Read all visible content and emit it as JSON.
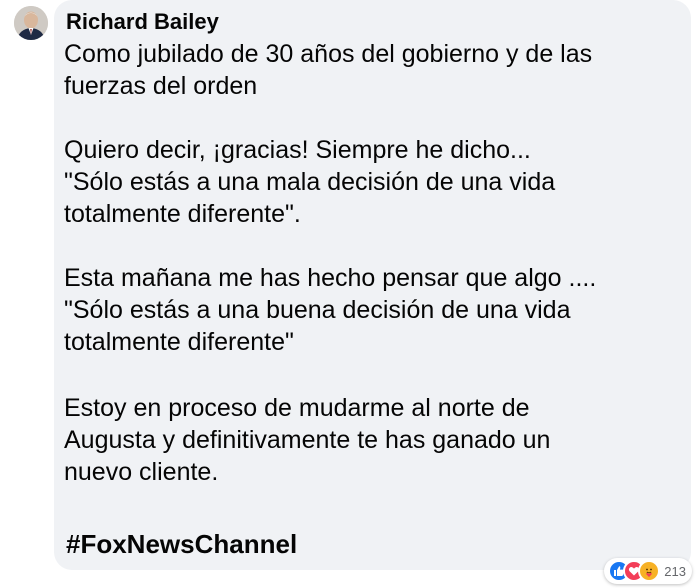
{
  "comment": {
    "author": "Richard Bailey",
    "paragraphs": [
      [
        "Como jubilado de 30 años del gobierno y de las",
        "fuerzas del orden"
      ],
      [
        "Quiero decir, ¡gracias! Siempre he dicho...",
        "\"Sólo estás a una mala decisión de una vida",
        "totalmente diferente\"."
      ],
      [
        "Esta mañana me has hecho pensar que algo ....",
        "\"Sólo estás a una buena decisión de una vida",
        "totalmente diferente\""
      ],
      [
        "Estoy en proceso de mudarme al norte de",
        "Augusta y definitivamente te has ganado un",
        "nuevo cliente."
      ]
    ],
    "hashtag": "#FoxNewsChannel"
  },
  "reactions": {
    "icons": [
      "like-icon",
      "love-icon",
      "care-icon"
    ],
    "count": "213"
  },
  "colors": {
    "bubble": "#f0f2f5",
    "text": "#050505",
    "like": "#1877f2",
    "love": "#f33e58",
    "care": "#f7b125"
  }
}
